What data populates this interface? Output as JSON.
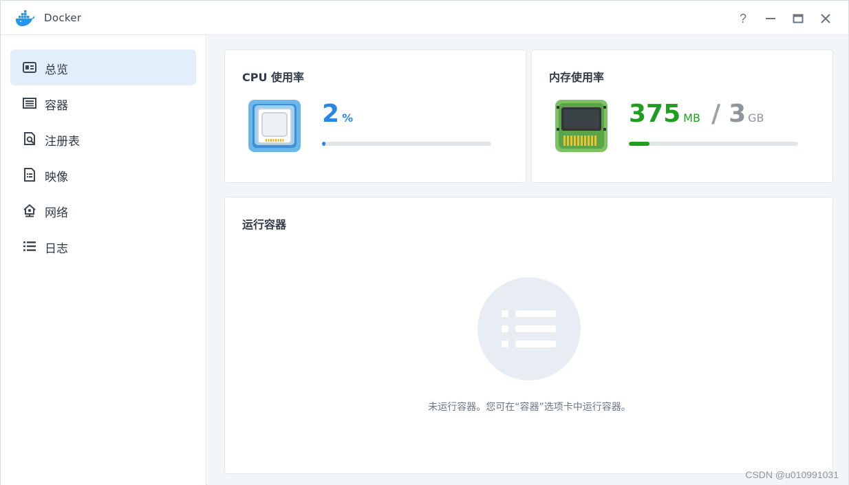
{
  "window": {
    "title": "Docker",
    "controls": {
      "help": "?",
      "minimize_icon": "minimize-icon",
      "maximize_icon": "maximize-icon",
      "close_icon": "close-icon"
    }
  },
  "sidebar": {
    "items": [
      {
        "label": "总览",
        "icon": "overview-icon",
        "active": true
      },
      {
        "label": "容器",
        "icon": "container-icon",
        "active": false
      },
      {
        "label": "注册表",
        "icon": "registry-icon",
        "active": false
      },
      {
        "label": "映像",
        "icon": "image-icon",
        "active": false
      },
      {
        "label": "网络",
        "icon": "network-icon",
        "active": false
      },
      {
        "label": "日志",
        "icon": "log-icon",
        "active": false
      }
    ]
  },
  "cpu": {
    "title": "CPU 使用率",
    "value": "2",
    "unit": "%",
    "fraction": 0.02,
    "color": "#2787e8"
  },
  "memory": {
    "title": "内存使用率",
    "used": "375",
    "used_unit": "MB",
    "separator": "/",
    "total": "3",
    "total_unit": "GB",
    "fraction": 0.12,
    "color": "#1f9e1f"
  },
  "running": {
    "title": "运行容器",
    "empty_icon": "list-icon",
    "empty_message": "未运行容器。您可在“容器”选项卡中运行容器。"
  },
  "watermark": "CSDN @u010991031",
  "colors": {
    "accent": "#2787e8",
    "active_nav": "#e3eefb",
    "memory": "#1f9e1f"
  }
}
